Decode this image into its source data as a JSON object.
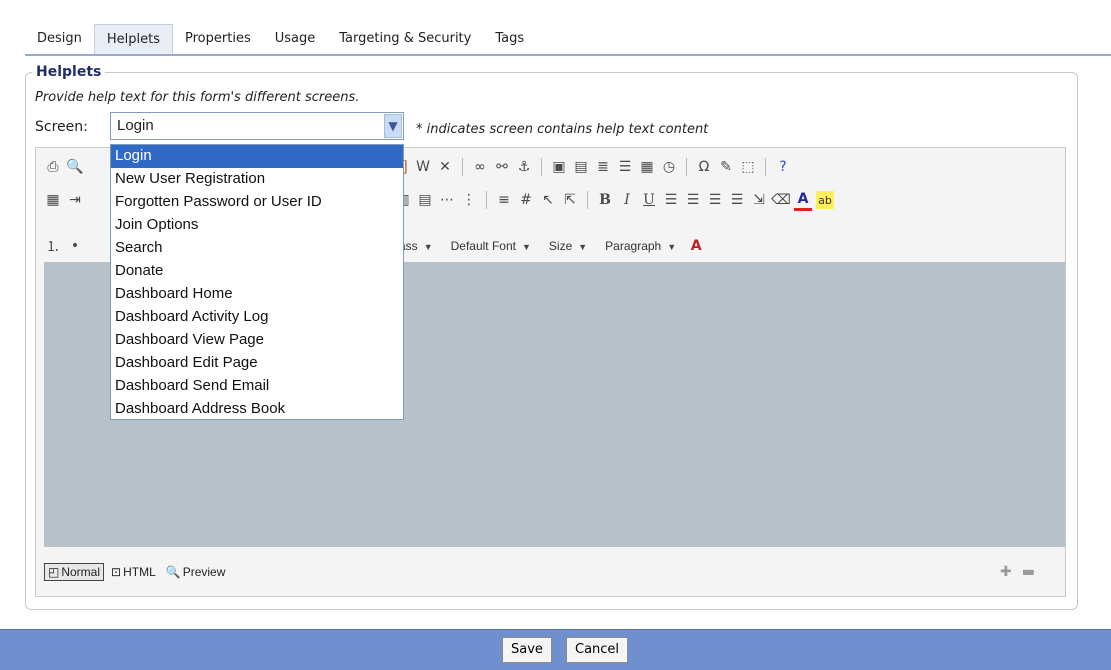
{
  "tabs": [
    "Design",
    "Helplets",
    "Properties",
    "Usage",
    "Targeting & Security",
    "Tags"
  ],
  "active_tab": "Helplets",
  "helplets": {
    "legend": "Helplets",
    "description": "Provide help text for this form's different screens.",
    "screen_label": "Screen:",
    "screen_value": "Login",
    "hint": "* indicates screen contains help text content",
    "screen_options": [
      "Login",
      "New User Registration",
      "Forgotten Password or User ID",
      "Join Options",
      "Search",
      "Donate",
      "Dashboard Home",
      "Dashboard Activity Log",
      "Dashboard View Page",
      "Dashboard Edit Page",
      "Dashboard Send Email",
      "Dashboard Address Book"
    ]
  },
  "editor": {
    "toolbar_dropdowns": {
      "class_label": "ass",
      "font_label": "Default Font",
      "size_label": "Size",
      "paragraph_label": "Paragraph"
    },
    "modes": {
      "normal": "Normal",
      "html": "HTML",
      "preview": "Preview"
    }
  },
  "footer": {
    "save_label": "Save",
    "cancel_label": "Cancel"
  },
  "colors": {
    "footer_bg": "#6f8fcf",
    "selected_bg": "#3169c6",
    "legend": "#1f2f6b",
    "content_bg": "#b7c1c9"
  }
}
